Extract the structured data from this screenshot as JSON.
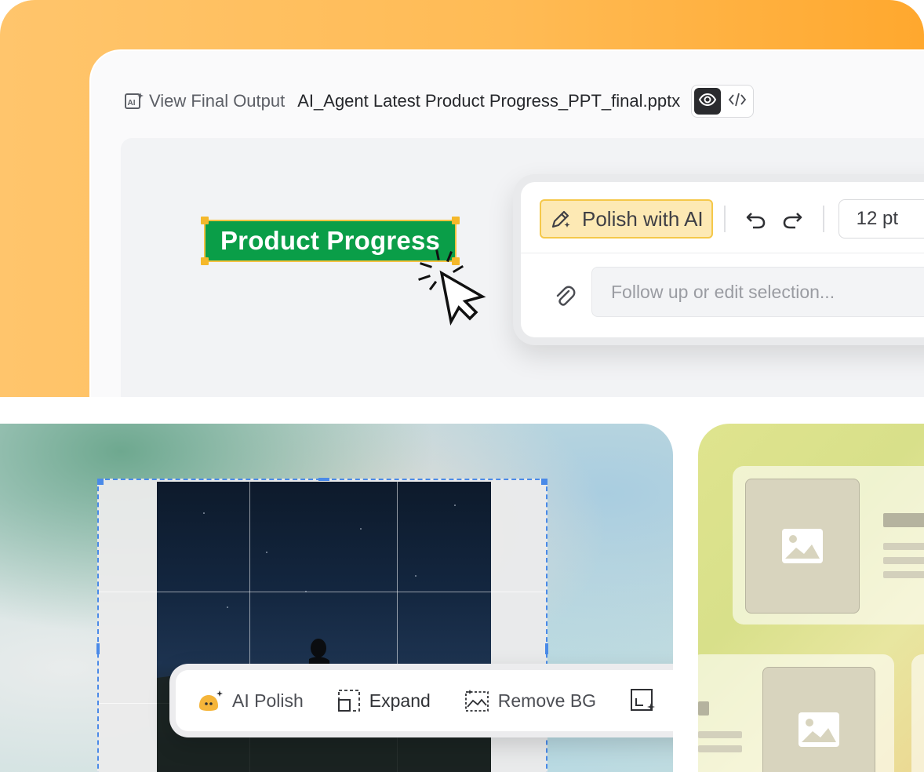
{
  "output_header": {
    "label": "View Final Output",
    "file_name": "AI_Agent Latest Product Progress_PPT_final.pptx"
  },
  "slide": {
    "selected_text": "Product Progress"
  },
  "text_toolbar": {
    "polish_label": "Polish with AI",
    "font_size": "12 pt",
    "follow_up_placeholder": "Follow up or edit selection..."
  },
  "image_toolbar": {
    "ai_polish_label": "AI Polish",
    "expand_label": "Expand",
    "remove_bg_label": "Remove BG"
  },
  "colors": {
    "title_green": "#0a9e48",
    "selection_yellow": "#f5c242",
    "polish_highlight": "#fde9b4",
    "crop_blue": "#4a8ae8"
  },
  "icons": [
    "ai-document-icon",
    "eye-icon",
    "code-icon",
    "pencil-sparkle-icon",
    "undo-icon",
    "redo-icon",
    "paperclip-icon",
    "ai-polish-mascot-icon",
    "expand-icon",
    "remove-bg-icon",
    "ai-resize-icon",
    "image-icon"
  ]
}
